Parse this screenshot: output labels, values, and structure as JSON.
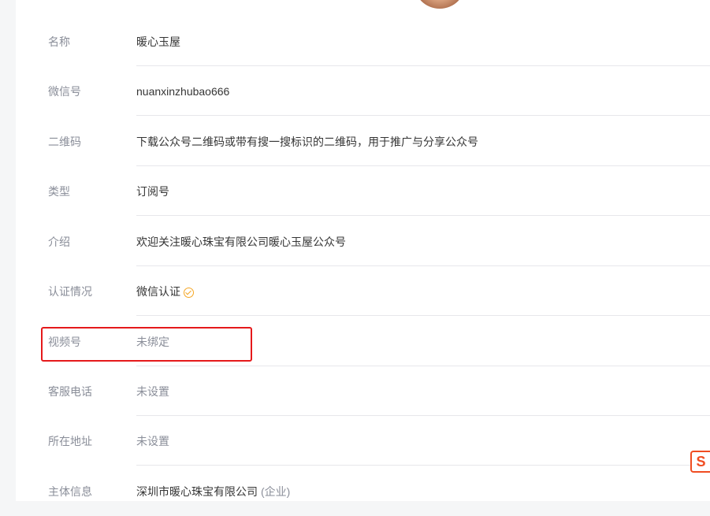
{
  "profile": {
    "rows": [
      {
        "key": "name",
        "label": "名称",
        "value": "暖心玉屋",
        "muted": false
      },
      {
        "key": "wechat_id",
        "label": "微信号",
        "value": "nuanxinzhubao666",
        "muted": false
      },
      {
        "key": "qrcode",
        "label": "二维码",
        "value": "下载公众号二维码或带有搜一搜标识的二维码，用于推广与分享公众号",
        "muted": false
      },
      {
        "key": "type",
        "label": "类型",
        "value": "订阅号",
        "muted": false
      },
      {
        "key": "intro",
        "label": "介绍",
        "value": "欢迎关注暖心珠宝有限公司暖心玉屋公众号",
        "muted": false
      },
      {
        "key": "verification",
        "label": "认证情况",
        "value": "微信认证",
        "muted": false
      },
      {
        "key": "channels",
        "label": "视频号",
        "value": "未绑定",
        "muted": true
      },
      {
        "key": "service_phone",
        "label": "客服电话",
        "value": "未设置",
        "muted": true
      },
      {
        "key": "address",
        "label": "所在地址",
        "value": "未设置",
        "muted": true
      },
      {
        "key": "entity",
        "label": "主体信息",
        "value": "深圳市暖心珠宝有限公司",
        "suffix": "(企业)",
        "muted": false
      }
    ]
  },
  "icons": {
    "verified": "check-circle-icon",
    "floating": "s-logo-icon"
  },
  "colors": {
    "highlight": "#e5191b",
    "verified": "#f5a623",
    "floating_icon": "#f04d22"
  },
  "floating_icon_text": "S"
}
